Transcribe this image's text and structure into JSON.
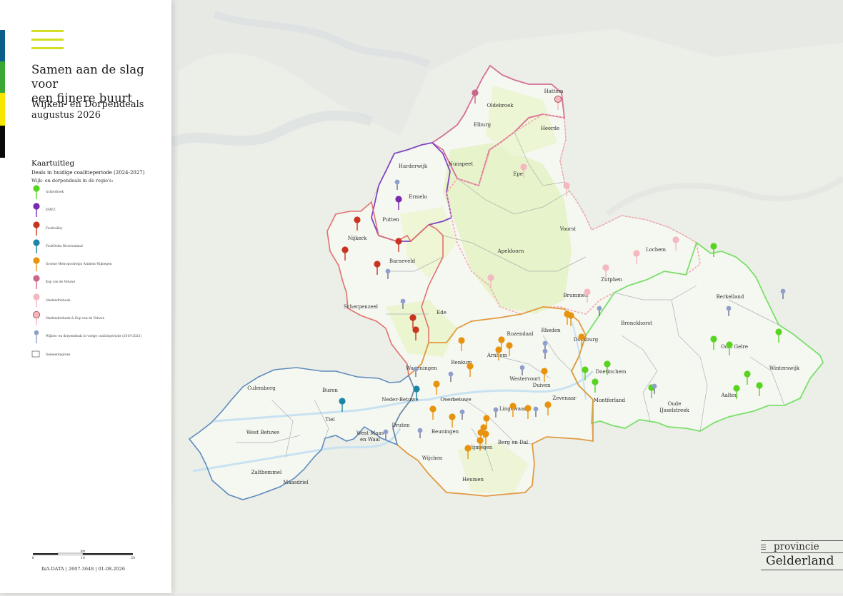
{
  "sidebar": {
    "stripe_colors": [
      "#0a5f8a",
      "#3aa832",
      "#f6e500",
      "#0a0a0a"
    ],
    "menu_icon": "hamburger-icon",
    "menu_color": "#d6de23",
    "title_line1": "Samen aan de slag voor",
    "title_line2": "een fijnere buurt",
    "subtitle_line1": "Wijken- en Dorpendeals",
    "subtitle_line2": "augustus 2026"
  },
  "legend": {
    "heading": "Kaartuitleg",
    "subheading": "Deals in huidige coalitieperiode (2024-2027)",
    "group_label": "Wijk- en dorpendeals in de regio's:",
    "items": [
      {
        "label": "Achterhoek",
        "color": "#58d41f",
        "kind": "pin"
      },
      {
        "label": "EMFZ",
        "color": "#7a2ab0",
        "kind": "pin"
      },
      {
        "label": "Foodvalley",
        "color": "#c9341f",
        "kind": "pin"
      },
      {
        "label": "FruitDelta Rivierenland",
        "color": "#1b86a8",
        "kind": "pin"
      },
      {
        "label": "Groene Metropoolregio Arnhem-Nijmegen",
        "color": "#e8930e",
        "kind": "pin"
      },
      {
        "label": "Kop van de Veluwe",
        "color": "#c9688f",
        "kind": "pin"
      },
      {
        "label": "Stedendriehoek",
        "color": "#f5b8bf",
        "kind": "pin"
      },
      {
        "label": "Stedendriehoek & Kop van de Veluwe",
        "color": "#f5b8bf",
        "kind": "pin-ring"
      },
      {
        "label": "Wijken- en dorpendeals in vorige coalitieperiode (2019-2023)",
        "color": "#8f9fcc",
        "kind": "pin-small"
      },
      {
        "label": "Gemeentegrens",
        "color": "#ffffff",
        "kind": "box"
      }
    ]
  },
  "scalebar": {
    "unit": "km",
    "ticks": [
      "0",
      "10",
      "20"
    ]
  },
  "credit": "IkA-DATA | 2607-3648 | 01-08-2026",
  "logo": {
    "line1": "provincie",
    "line2": "Gelderland"
  },
  "map": {
    "place_labels": [
      "Hattem",
      "Oldebroek",
      "Elburg",
      "Heerde",
      "Nunspeet",
      "Harderwijk",
      "Ermelo",
      "Epe",
      "Putten",
      "Nijkerk",
      "Voorst",
      "Apeldoorn",
      "Lochem",
      "Barneveld",
      "Zutphen",
      "Brummen",
      "Berkelland",
      "Scherpenzeel",
      "Ede",
      "Rheden",
      "Bronckhorst",
      "Rozendaal",
      "Doesburg",
      "Oost Gelre",
      "Arnhem",
      "Renkum",
      "Wageningen",
      "Westervoort",
      "Duiven",
      "Doetinchem",
      "Winterswijk",
      "Culemborg",
      "Buren",
      "Neder-Betuwe",
      "Overbetuwe",
      "Zevenaar",
      "Montferland",
      "Oude IJsselstreek",
      "Aalten",
      "Tiel",
      "Lingewaard",
      "West Betuwe",
      "West Maas en Waal",
      "Druten",
      "Beuningen",
      "Nijmegen",
      "Berg en Dal",
      "Wijchen",
      "Zaltbommel",
      "Maasdriel",
      "Heumen"
    ]
  }
}
